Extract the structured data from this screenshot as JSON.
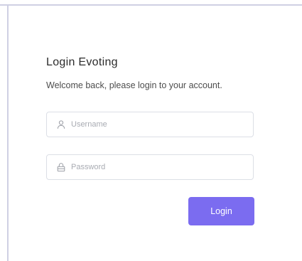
{
  "login": {
    "title": "Login Evoting",
    "subtitle": "Welcome back, please login to your account.",
    "username": {
      "placeholder": "Username",
      "value": "",
      "icon": "user-icon"
    },
    "password": {
      "placeholder": "Password",
      "value": "",
      "icon": "lock-icon"
    },
    "button_label": "Login"
  },
  "colors": {
    "accent": "#7b6cf0",
    "frame_border": "#cfd0e3",
    "input_border": "#dcdfe6",
    "placeholder": "#a8abb2"
  }
}
